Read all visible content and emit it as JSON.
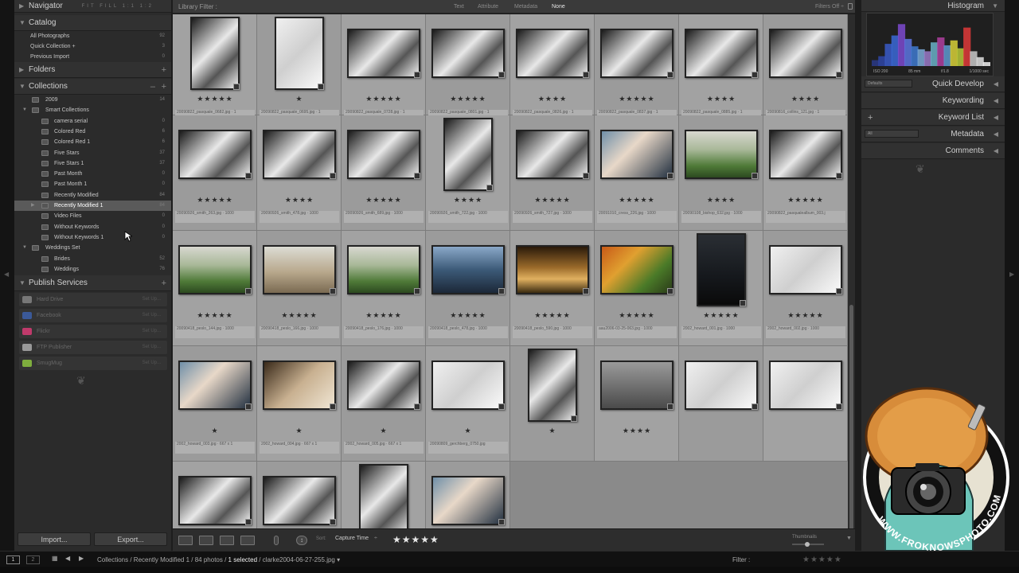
{
  "left_panel": {
    "navigator": {
      "title": "Navigator",
      "options": "FIT FILL 1:1 1:2"
    },
    "catalog": {
      "title": "Catalog",
      "items": [
        {
          "label": "All Photographs",
          "count": "92"
        },
        {
          "label": "Quick Collection +",
          "count": "3"
        },
        {
          "label": "Previous Import",
          "count": "0"
        }
      ]
    },
    "folders": {
      "title": "Folders"
    },
    "collections": {
      "title": "Collections",
      "items": [
        {
          "label": "2009",
          "count": "14"
        },
        {
          "label": "Smart Collections",
          "count": ""
        },
        {
          "label": "camera serial",
          "count": "0"
        },
        {
          "label": "Colored Red",
          "count": "6"
        },
        {
          "label": "Colored Red 1",
          "count": "6"
        },
        {
          "label": "Five Stars",
          "count": "37"
        },
        {
          "label": "Five Stars 1",
          "count": "37"
        },
        {
          "label": "Past Month",
          "count": "0"
        },
        {
          "label": "Past Month 1",
          "count": "0"
        },
        {
          "label": "Recently Modified",
          "count": "84"
        },
        {
          "label": "Recently Modified 1",
          "count": "84"
        },
        {
          "label": "Video Files",
          "count": "0"
        },
        {
          "label": "Without Keywords",
          "count": "0"
        },
        {
          "label": "Without Keywords 1",
          "count": "0"
        },
        {
          "label": "Weddings Set",
          "count": ""
        },
        {
          "label": "Brides",
          "count": "52"
        },
        {
          "label": "Weddings",
          "count": "76"
        }
      ]
    },
    "publish": {
      "title": "Publish Services",
      "services": [
        {
          "label": "Hard Drive",
          "setup": "Set Up...",
          "color": "#777777"
        },
        {
          "label": "Facebook",
          "setup": "Set Up...",
          "color": "#3b5998"
        },
        {
          "label": "Flickr",
          "setup": "Set Up...",
          "color": "#c03a6b"
        },
        {
          "label": "FTP Publisher",
          "setup": "Set Up...",
          "color": "#999999"
        },
        {
          "label": "SmugMug",
          "setup": "Set Up...",
          "color": "#7fae3e"
        }
      ]
    },
    "import_label": "Import...",
    "export_label": "Export..."
  },
  "filter_bar": {
    "label": "Library Filter :",
    "tabs": [
      "Text",
      "Attribute",
      "Metadata",
      "None"
    ],
    "active_tab": "None",
    "filters_off": "Filters Off ÷"
  },
  "grid": {
    "rows": [
      [
        {
          "stars": "★★★★★",
          "caption": "20090822_pasquale_0682.jpg · 1",
          "shape": "tall",
          "tone": "bw"
        },
        {
          "stars": "★",
          "caption": "20090822_pasquale_0695.jpg · 1",
          "shape": "tall",
          "tone": "light"
        },
        {
          "stars": "★★★★★",
          "caption": "20090822_pasquale_0728.jpg · 1",
          "shape": "wide",
          "tone": "bw"
        },
        {
          "stars": "★★★★★",
          "caption": "20090822_pasquale_0801.jpg · 1",
          "shape": "wide",
          "tone": "bw"
        },
        {
          "stars": "★★★★",
          "caption": "20090822_pasquale_0826.jpg · 1",
          "shape": "wide",
          "tone": "bw"
        },
        {
          "stars": "★★★★★",
          "caption": "20090822_pasquale_0837.jpg · 1",
          "shape": "wide",
          "tone": "bw"
        },
        {
          "stars": "★★★★",
          "caption": "20090822_pasquale_0885.jpg · 1",
          "shape": "wide",
          "tone": "bw"
        },
        {
          "stars": "★★★★",
          "caption": "20090816_collins_121.jpg · 1",
          "shape": "wide",
          "tone": "bw"
        }
      ],
      [
        {
          "stars": "★★★★★",
          "caption": "20090926_smith_263.jpg · 1000",
          "shape": "wide",
          "tone": "bw"
        },
        {
          "stars": "★★★★",
          "caption": "20090926_smith_478.jpg · 1000",
          "shape": "wide",
          "tone": "bw"
        },
        {
          "stars": "★★★★★",
          "caption": "20090926_smith_689.jpg · 1000",
          "shape": "wide",
          "tone": "bw"
        },
        {
          "stars": "★★★★",
          "caption": "20090926_smith_722.jpg · 1000",
          "shape": "tall",
          "tone": "bw"
        },
        {
          "stars": "★★★★★",
          "caption": "20090926_smith_727.jpg · 1000",
          "shape": "wide",
          "tone": "bw"
        },
        {
          "stars": "★★★★★",
          "caption": "20091010_cress_226.jpg · 1000",
          "shape": "wide",
          "tone": "color"
        },
        {
          "stars": "★★★★",
          "caption": "20090108_bishop_632.jpg · 1000",
          "shape": "wide",
          "tone": "green"
        },
        {
          "stars": "★★★★★",
          "caption": "20090822_pasqualealbum_003.j",
          "shape": "wide",
          "tone": "bw"
        }
      ],
      [
        {
          "stars": "★★★★★",
          "caption": "20090418_peslo_144.jpg · 1000",
          "shape": "wide",
          "tone": "green"
        },
        {
          "stars": "★★★★★",
          "caption": "20090418_peslo_166.jpg · 1000",
          "shape": "wide",
          "tone": "tan"
        },
        {
          "stars": "★★★★★",
          "caption": "20090418_peslo_176.jpg · 1000",
          "shape": "wide",
          "tone": "green"
        },
        {
          "stars": "★★★★★",
          "caption": "20090418_peslo_478.jpg · 1000",
          "shape": "wide",
          "tone": "blue"
        },
        {
          "stars": "★★★★★",
          "caption": "20090418_peslo_590.jpg · 1000",
          "shape": "wide",
          "tone": "warm"
        },
        {
          "stars": "★★★★★",
          "caption": "aau2006-03-25-063.jpg · 1000",
          "shape": "wide",
          "tone": "autumn"
        },
        {
          "stars": "★★★★★",
          "caption": "2002_howard_001.jpg · 1000",
          "shape": "tall",
          "tone": "dark"
        },
        {
          "stars": "★★★★★",
          "caption": "2002_howard_002.jpg · 1000",
          "shape": "wide",
          "tone": "light"
        }
      ],
      [
        {
          "stars": "★",
          "caption": "2002_howard_003.jpg · 667 x 1",
          "shape": "wide",
          "tone": "color"
        },
        {
          "stars": "★",
          "caption": "2002_howard_004.jpg · 667 x 1",
          "shape": "wide",
          "tone": "sepia"
        },
        {
          "stars": "★",
          "caption": "2002_howard_005.jpg · 667 x 1",
          "shape": "wide",
          "tone": "bw"
        },
        {
          "stars": "★",
          "caption": "20090809_gerchberg_0750.jpg",
          "shape": "wide",
          "tone": "light"
        },
        {
          "stars": "★",
          "caption": "",
          "shape": "tall",
          "tone": "bw"
        },
        {
          "stars": "★★★★",
          "caption": "",
          "shape": "wide",
          "tone": "gray"
        },
        {
          "stars": "",
          "caption": "",
          "shape": "wide",
          "tone": "light"
        },
        {
          "stars": "",
          "caption": "",
          "shape": "wide",
          "tone": "light"
        }
      ],
      [
        {
          "stars": "",
          "caption": "",
          "shape": "wide",
          "tone": "bw"
        },
        {
          "stars": "",
          "caption": "",
          "shape": "wide",
          "tone": "bw"
        },
        {
          "stars": "",
          "caption": "",
          "shape": "tall",
          "tone": "bw"
        },
        {
          "stars": "",
          "caption": "",
          "shape": "wide",
          "tone": "color"
        }
      ]
    ]
  },
  "toolbar": {
    "sort_label": "Sort:",
    "sort_value": "Capture Time",
    "rating": "★★★★★",
    "thumbnails_label": "Thumbnails"
  },
  "right_panel": {
    "histogram": {
      "title": "Histogram",
      "iso": "ISO 200",
      "focal": "85 mm",
      "aperture": "f/1.8",
      "shutter": "1/1000 sec",
      "bars": [
        {
          "color": "#2a3a88",
          "value": 0.12
        },
        {
          "color": "#2f46a8",
          "value": 0.2
        },
        {
          "color": "#3a5bc8",
          "value": 0.45
        },
        {
          "color": "#3b6ad8",
          "value": 0.62
        },
        {
          "color": "#7d4ad0",
          "value": 0.85
        },
        {
          "color": "#5d76e0",
          "value": 0.55
        },
        {
          "color": "#3f7ad0",
          "value": 0.4
        },
        {
          "color": "#7baad8",
          "value": 0.34
        },
        {
          "color": "#9a7ac8",
          "value": 0.3
        },
        {
          "color": "#6ab2c8",
          "value": 0.48
        },
        {
          "color": "#b040a0",
          "value": 0.58
        },
        {
          "color": "#5e9ad0",
          "value": 0.42
        },
        {
          "color": "#d8d038",
          "value": 0.52
        },
        {
          "color": "#b8c838",
          "value": 0.36
        },
        {
          "color": "#e03a3a",
          "value": 0.78
        },
        {
          "color": "#c9c9c9",
          "value": 0.3
        },
        {
          "color": "#e0e0e0",
          "value": 0.18
        },
        {
          "color": "#eeeeee",
          "value": 0.08
        }
      ]
    },
    "quick_develop": {
      "title": "Quick Develop",
      "preset": "Defaults"
    },
    "keywording": {
      "title": "Keywording"
    },
    "keyword_list": {
      "title": "Keyword List"
    },
    "metadata": {
      "title": "Metadata",
      "preset": "All"
    },
    "comments": {
      "title": "Comments"
    }
  },
  "bottom_bar": {
    "screen1": "1",
    "screen2": "2",
    "path_prefix": "Collections / Recently Modified 1 / 84 photos /",
    "selected": "1 selected",
    "path_suffix": "/ clarke2004-06-27-255.jpg",
    "filter_label": "Filter :"
  },
  "watermark": {
    "text": "WWW.FROKNOWSPHOTO.COM"
  }
}
